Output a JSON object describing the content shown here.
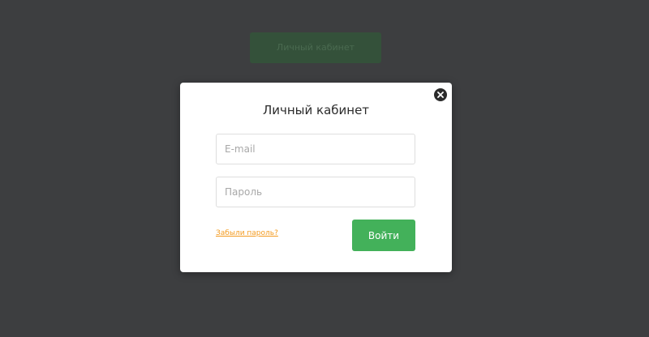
{
  "background": {
    "button_label": "Личный кабинет"
  },
  "modal": {
    "title": "Личный кабинет",
    "email_placeholder": "E-mail",
    "password_placeholder": "Пароль",
    "forgot_password_label": "Забыли пароль?",
    "submit_label": "Войти",
    "close_icon": "close-icon"
  },
  "colors": {
    "overlay": "#3d3e40",
    "accent_green": "#43b15a",
    "link_orange": "#f39a1e"
  }
}
